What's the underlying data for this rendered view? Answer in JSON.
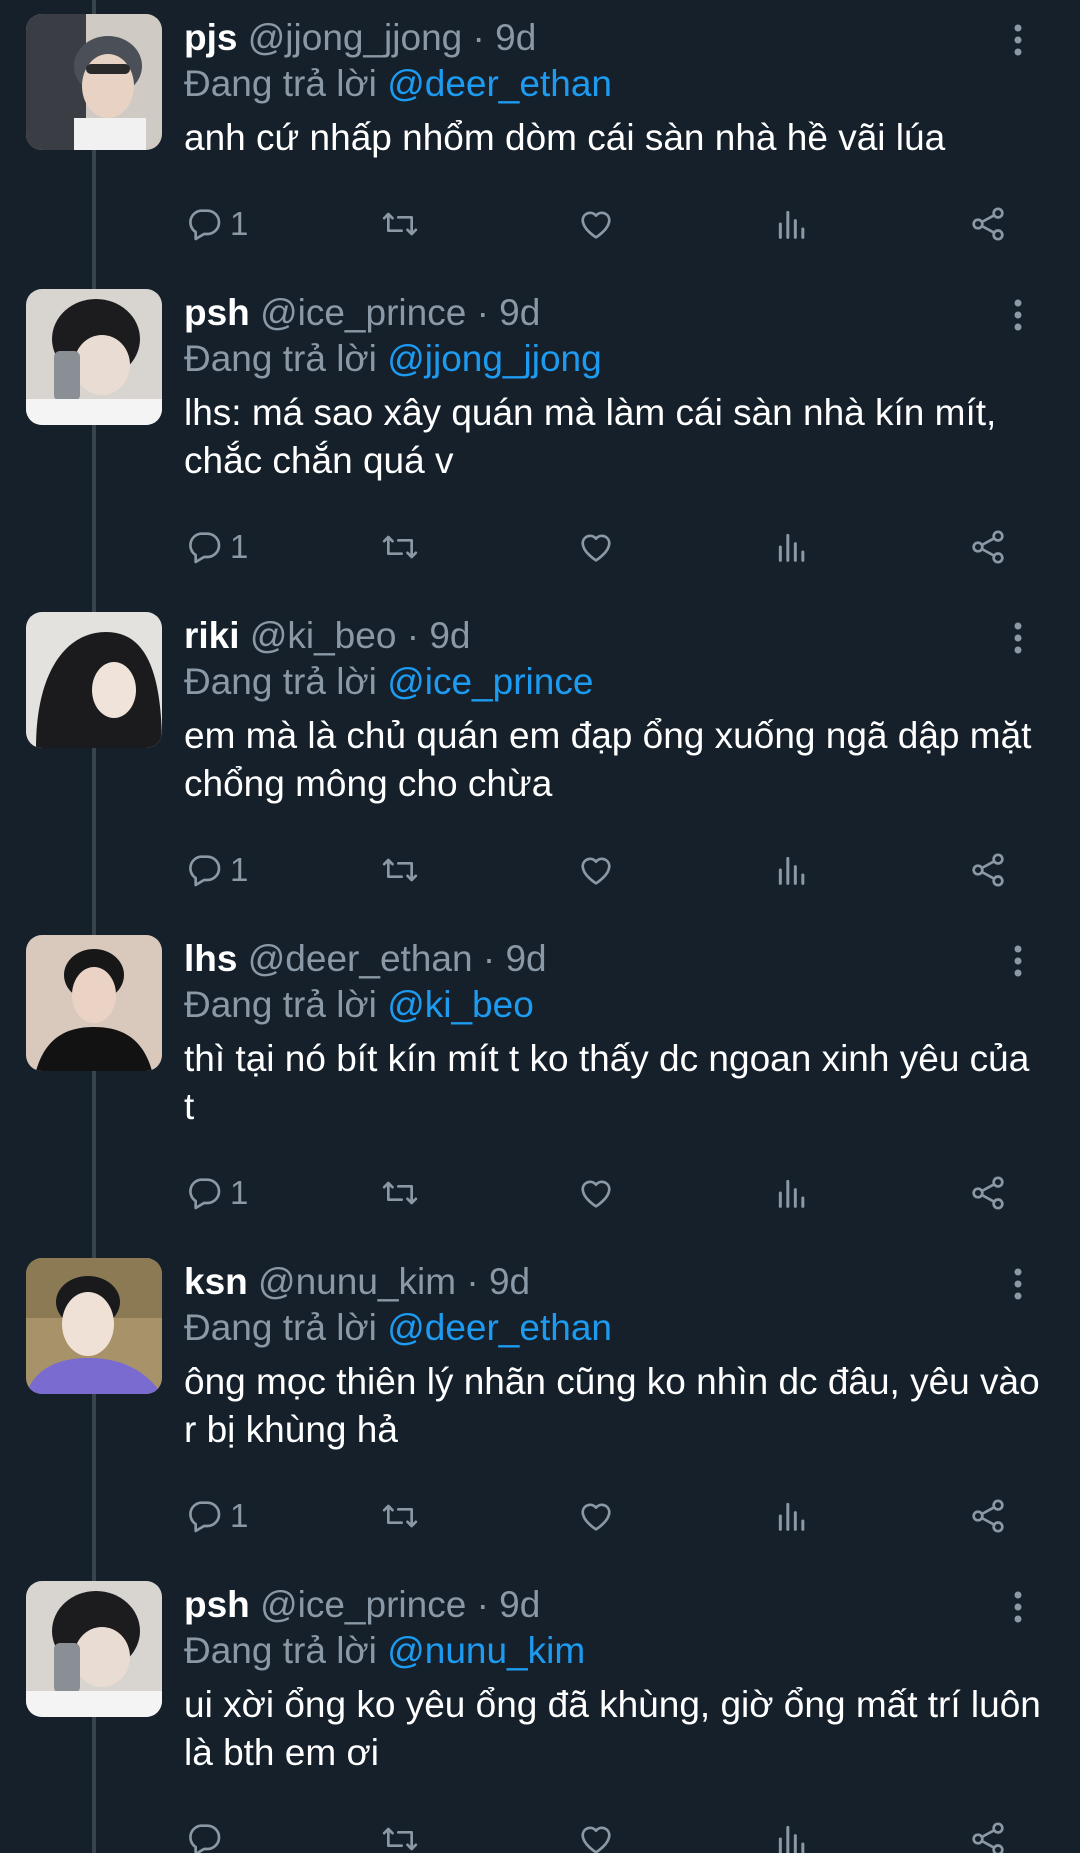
{
  "tweets": [
    {
      "name": "pjs",
      "handle": "@jjong_jjong",
      "sep": "·",
      "time": "9d",
      "replying_prefix": "Đang trả lời",
      "replying_to": "@deer_ethan",
      "text": "anh cứ nhấp nhổm dòm cái sàn nhà hề vãi lúa",
      "reply_count": "1",
      "avatar_color": "#c9c5bd"
    },
    {
      "name": "psh",
      "handle": "@ice_prince",
      "sep": "·",
      "time": "9d",
      "replying_prefix": "Đang trả lời",
      "replying_to": "@jjong_jjong",
      "text": "lhs: má sao xây quán mà làm cái sàn nhà kín mít, chắc chắn quá v",
      "reply_count": "1",
      "avatar_color": "#bcb8b4"
    },
    {
      "name": "riki",
      "handle": "@ki_beo",
      "sep": "·",
      "time": "9d",
      "replying_prefix": "Đang trả lời",
      "replying_to": "@ice_prince",
      "text": "em mà là chủ quán em đạp ổng xuống ngã dập mặt chổng mông cho chừa",
      "reply_count": "1",
      "avatar_color": "#d6d4d2"
    },
    {
      "name": "lhs",
      "handle": "@deer_ethan",
      "sep": "·",
      "time": "9d",
      "replying_prefix": "Đang trả lời",
      "replying_to": "@ki_beo",
      "text": "thì tại nó bít kín mít t ko thấy dc ngoan xinh yêu của t",
      "reply_count": "1",
      "avatar_color": "#cdbfb5"
    },
    {
      "name": "ksn",
      "handle": "@nunu_kim",
      "sep": "·",
      "time": "9d",
      "replying_prefix": "Đang trả lời",
      "replying_to": "@deer_ethan",
      "text": "ông mọc thiên lý nhãn cũng ko nhìn dc đâu, yêu vào r bị khùng hả",
      "reply_count": "1",
      "avatar_color": "#b8a27a"
    },
    {
      "name": "psh",
      "handle": "@ice_prince",
      "sep": "·",
      "time": "9d",
      "replying_prefix": "Đang trả lời",
      "replying_to": "@nunu_kim",
      "text": "ui xời ổng ko yêu ổng đã khùng, giờ ổng mất trí luôn là bth em ơi",
      "reply_count": "",
      "avatar_color": "#bcb8b4"
    }
  ],
  "colors": {
    "background": "#15202b",
    "secondary_text": "#8b98a5",
    "mention": "#1d9bf0",
    "thread_line": "#38444d"
  },
  "icons": [
    "reply-icon",
    "retweet-icon",
    "like-icon",
    "views-icon",
    "share-icon",
    "more-icon"
  ]
}
